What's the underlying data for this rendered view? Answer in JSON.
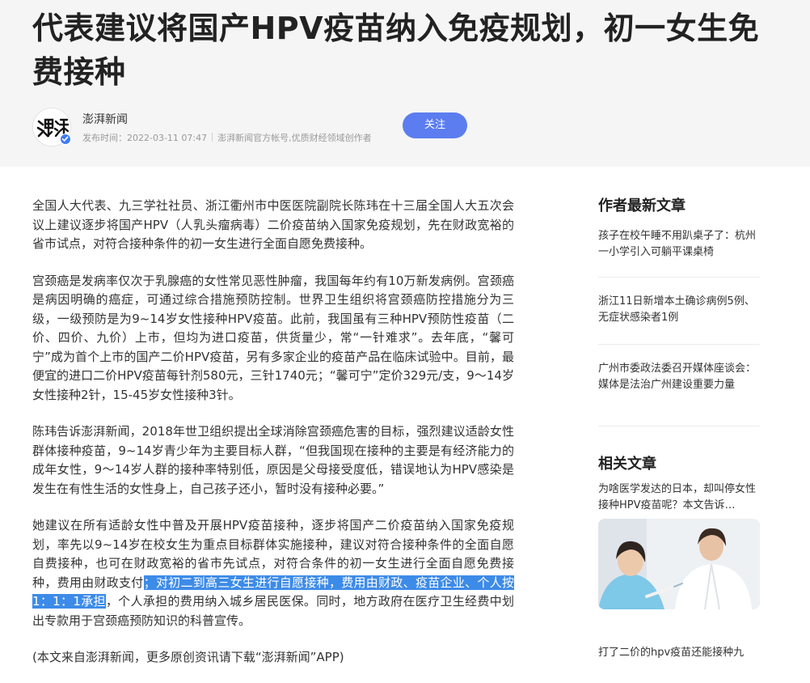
{
  "article": {
    "title": "代表建议将国产HPV疫苗纳入免疫规划，初一女生免费接种",
    "author": "澎湃新闻",
    "publish_time": "发布时间：2022-03-11 07:47",
    "author_desc": "澎湃新闻官方帐号,优质财经领域创作者",
    "follow_label": "关注",
    "paragraphs": {
      "p1": "全国人大代表、九三学社社员、浙江衢州市中医医院副院长陈玮在十三届全国人大五次会议上建议逐步将国产HPV（人乳头瘤病毒）二价疫苗纳入国家免疫规划，先在财政宽裕的省市试点，对符合接种条件的初一女生进行全面自愿免费接种。",
      "p2": "宫颈癌是发病率仅次于乳腺癌的女性常见恶性肿瘤，我国每年约有10万新发病例。宫颈癌是病因明确的癌症，可通过综合措施预防控制。世界卫生组织将宫颈癌防控措施分为三级，一级预防是为9~14岁女性接种HPV疫苗。此前，我国虽有三种HPV预防性疫苗（二价、四价、九价）上市，但均为进口疫苗，供货量少，常“一针难求”。去年底，“馨可宁”成为首个上市的国产二价HPV疫苗，另有多家企业的疫苗产品在临床试验中。目前，最便宜的进口二价HPV疫苗每针剂580元，三针1740元；“馨可宁”定价329元/支，9～14岁女性接种2针，15-45岁女性接种3针。",
      "p3": "陈玮告诉澎湃新闻，2018年世卫组织提出全球消除宫颈癌危害的目标，强烈建议适龄女性群体接种疫苗，9~14岁青少年为主要目标人群，“但我国现在接种的主要是有经济能力的成年女性，9～14岁人群的接种率特别低，原因是父母接受度低，错误地认为HPV感染是发生在有性生活的女性身上，自己孩子还小，暂时没有接种必要。”",
      "p4_before": "她建议在所有适龄女性中普及开展HPV疫苗接种，逐步将国产二价疫苗纳入国家免疫规划，率先以9~14岁在校女生为重点目标群体实施接种，建议对符合接种条件的全面自愿自费接种，也可在财政宽裕的省市先试点，对符合条件的初一女生进行全面自愿免费接种，费用由财政支付",
      "p4_highlight": "；对初二到高三女生进行自愿接种，费用由财政、疫苗企业、个人按1：1：1承担",
      "p4_after": "，个人承担的费用纳入城乡居民医保。同时，地方政府在医疗卫生经费中划出专款用于宫颈癌预防知识的科普宣传。",
      "source_note": "(本文来自澎湃新闻，更多原创资讯请下载“澎湃新闻”APP)"
    }
  },
  "sidebar": {
    "latest_heading": "作者最新文章",
    "latest": [
      "孩子在校午睡不用趴桌子了：杭州一小学引入可躺平课桌椅",
      "浙江11日新增本土确诊病例5例、无症状感染者1例",
      "广州市委政法委召开媒体座谈会：媒体是法治广州建设重要力量"
    ],
    "related_heading": "相关文章",
    "related": [
      "为啥医学发达的日本，却叫停女性接种HPV疫苗呢？本文告诉…",
      "打了二价的hpv疫苗还能接种九"
    ]
  },
  "colors": {
    "accent": "#5b7df0",
    "highlight": "#3d8be8",
    "header_bg": "#f5f5f5"
  }
}
